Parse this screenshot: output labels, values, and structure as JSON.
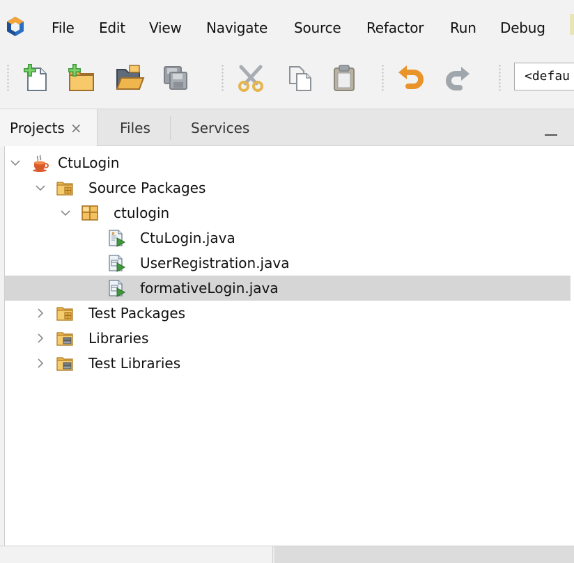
{
  "menu": {
    "items": [
      "File",
      "Edit",
      "View",
      "Navigate",
      "Source",
      "Refactor",
      "Run",
      "Debug"
    ]
  },
  "toolbar": {
    "buttons": [
      {
        "name": "new-file",
        "icon": "new-file-icon"
      },
      {
        "name": "new-project",
        "icon": "new-project-icon"
      },
      {
        "name": "open-project",
        "icon": "open-project-icon"
      },
      {
        "name": "save-all",
        "icon": "save-all-icon"
      },
      {
        "name": "cut",
        "icon": "scissors-icon"
      },
      {
        "name": "copy",
        "icon": "copy-icon"
      },
      {
        "name": "paste",
        "icon": "paste-icon"
      },
      {
        "name": "undo",
        "icon": "undo-icon"
      },
      {
        "name": "redo",
        "icon": "redo-icon"
      }
    ],
    "config_value": "<defau"
  },
  "tabs": {
    "projects": "Projects",
    "close_glyph": "×",
    "files": "Files",
    "services": "Services"
  },
  "tree": {
    "project": "CtuLogin",
    "source_packages": "Source Packages",
    "package": "ctulogin",
    "files": [
      "CtuLogin.java",
      "UserRegistration.java",
      "formativeLogin.java"
    ],
    "selected_file": "formativeLogin.java",
    "test_packages": "Test Packages",
    "libraries": "Libraries",
    "test_libraries": "Test Libraries"
  },
  "colors": {
    "selection": "#d6d6d6",
    "folder": "#e9b44c",
    "package": "#e3a93c",
    "java_badge": "#3e9a3c"
  }
}
